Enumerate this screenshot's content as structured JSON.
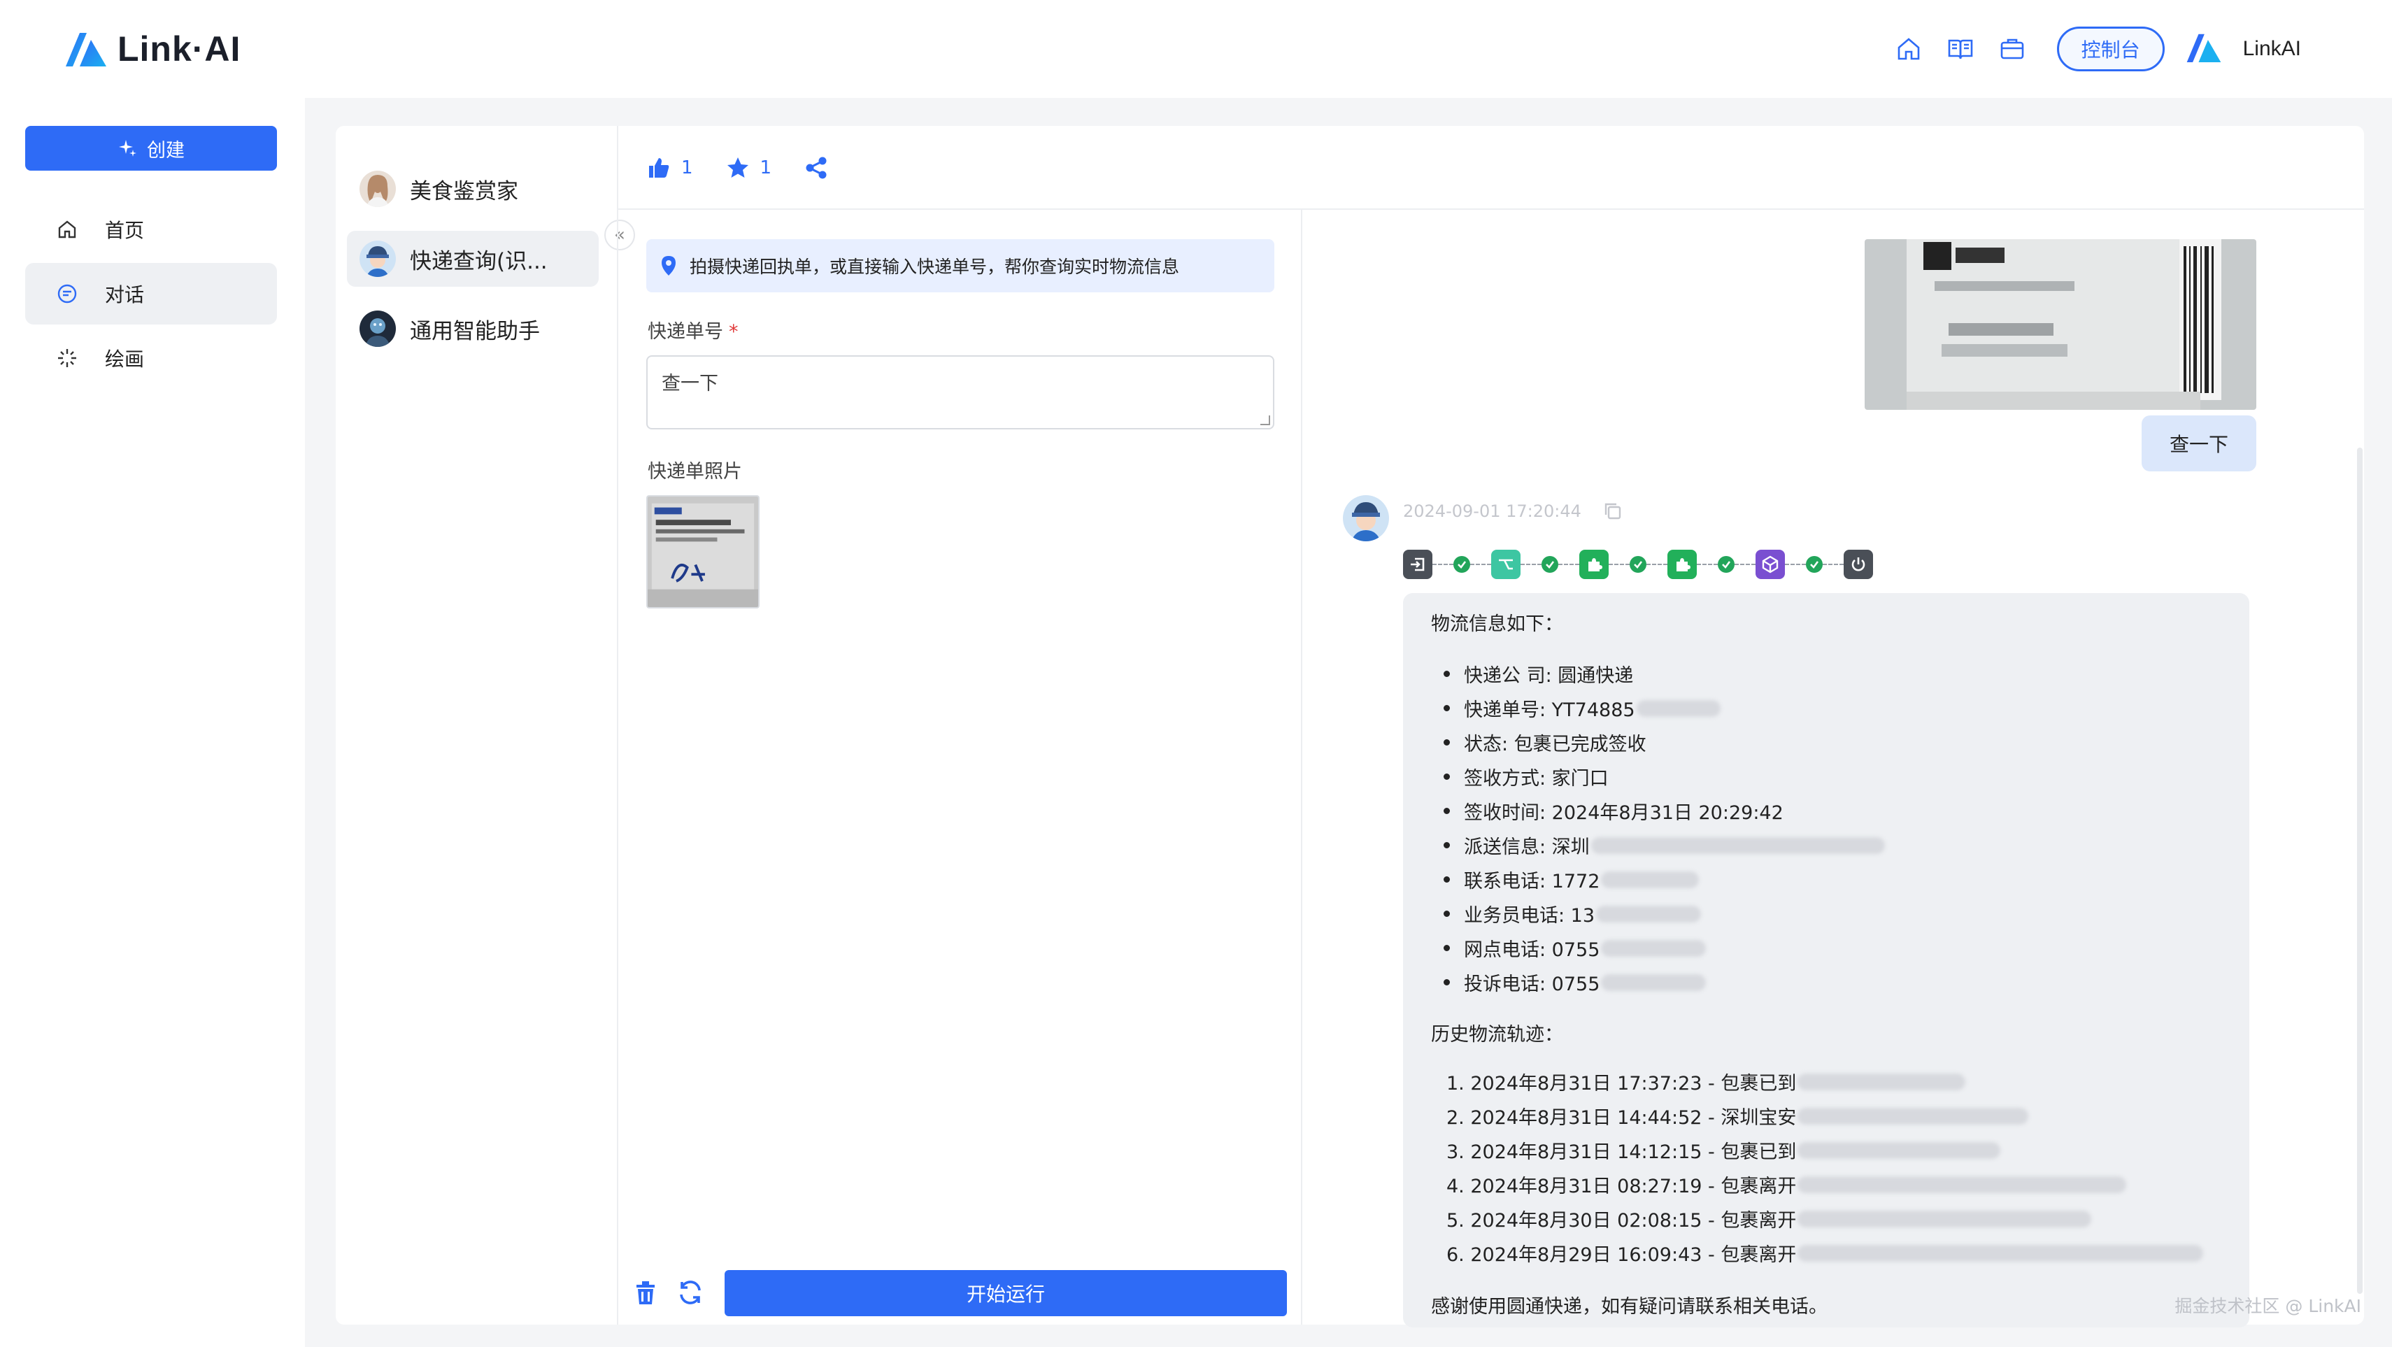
{
  "brand": {
    "name": "Link·AI",
    "accent": "#2e6bf6"
  },
  "topbar": {
    "console_label": "控制台",
    "user_name": "LinkAI"
  },
  "nav": {
    "create_label": "创建",
    "items": [
      {
        "label": "首页",
        "icon": "home-icon"
      },
      {
        "label": "对话",
        "icon": "chat-icon"
      },
      {
        "label": "绘画",
        "icon": "sparkle-icon"
      }
    ]
  },
  "agents": [
    {
      "name": "美食鉴赏家"
    },
    {
      "name": "快递查询(识..."
    },
    {
      "name": "通用智能助手"
    }
  ],
  "header": {
    "likes": "1",
    "stars": "1"
  },
  "form": {
    "tip": "拍摄快递回执单，或直接输入快递单号，帮你查询实时物流信息",
    "tracking_label": "快递单号",
    "required_mark": "*",
    "tracking_value": "查一下",
    "photo_label": "快递单照片",
    "run_label": "开始运行"
  },
  "chat": {
    "user_message": "查一下",
    "bot_time": "2024-09-01 17:20:44",
    "reply": {
      "intro": "物流信息如下：",
      "fields": [
        "快递公 司: 圆通快递",
        "快递单号: YT74885",
        "状态: 包裹已完成签收",
        "签收方式: 家门口",
        "签收时间: 2024年8月31日 20:29:42",
        "派送信息: 深圳",
        "联系电话: 1772",
        "业务员电话: 13",
        "网点电话: 0755",
        "投诉电话: 0755"
      ],
      "history_title": "历史物流轨迹：",
      "history": [
        "1. 2024年8月31日 17:37:23 - 包裹已到",
        "2. 2024年8月31日 14:44:52 - 深圳宝安",
        "3. 2024年8月31日 14:12:15 - 包裹已到",
        "4. 2024年8月31日 08:27:19 - 包裹离开",
        "5. 2024年8月30日 02:08:15 - 包裹离开",
        "6. 2024年8月29日 16:09:43 - 包裹离开"
      ],
      "outro": "感谢使用圆通快递，如有疑问请联系相关电话。"
    }
  },
  "watermark": "掘金技术社区 @ LinkAI"
}
